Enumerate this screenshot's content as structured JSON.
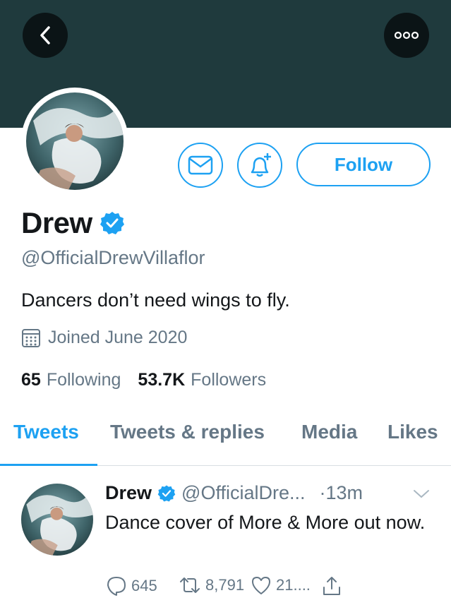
{
  "profile": {
    "display_name": "Drew",
    "handle": "@OfficialDrewVillaflor",
    "bio": "Dancers don’t need wings to fly.",
    "joined": "Joined June 2020",
    "following_count": "65",
    "following_label": "Following",
    "followers_count": "53.7K",
    "followers_label": "Followers",
    "follow_label": "Follow"
  },
  "icons": {
    "back": "chevron-left-icon",
    "more": "more-icon",
    "message": "envelope-icon",
    "notify": "bell-plus-icon",
    "verified": "verified-badge-icon",
    "calendar": "calendar-icon",
    "reply": "reply-icon",
    "retweet": "retweet-icon",
    "like": "heart-icon",
    "share": "share-icon"
  },
  "tabs": [
    {
      "label": "Tweets",
      "active": true
    },
    {
      "label": "Tweets & replies",
      "active": false
    },
    {
      "label": "Media",
      "active": false
    },
    {
      "label": "Likes",
      "active": false
    }
  ],
  "tweet": {
    "name": "Drew",
    "handle": "@OfficialDre...",
    "time": "·13m",
    "text": "Dance cover of More & More out now.",
    "replies": "645",
    "retweets": "8,791",
    "likes": "21...."
  },
  "colors": {
    "accent": "#1da1f2",
    "banner": "#1f3a3d",
    "muted_text": "#657786"
  }
}
